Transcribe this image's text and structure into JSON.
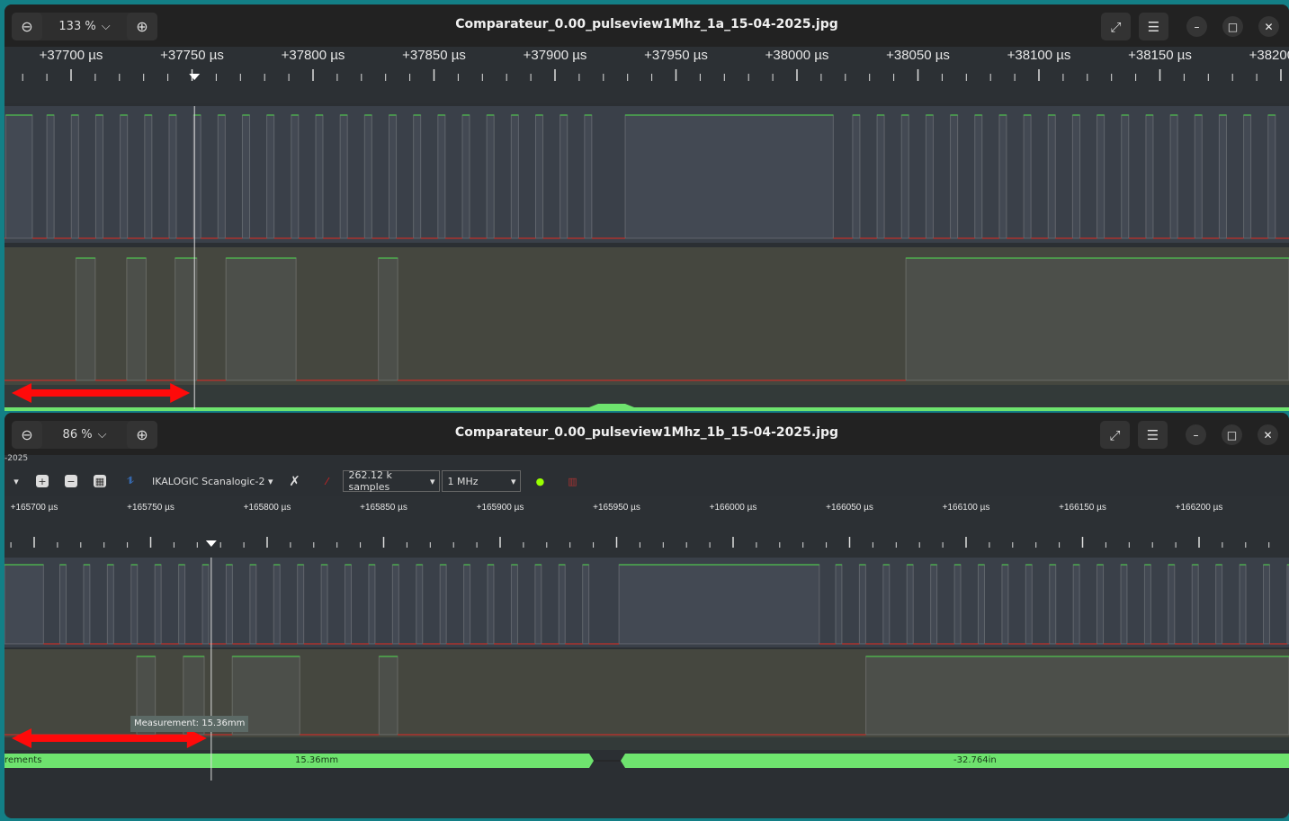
{
  "windows": [
    {
      "title": "Comparateur_0.00_pulseview1Mhz_1a_15-04-2025.jpg",
      "zoom": "133 %",
      "ruler": {
        "start": 37700,
        "end": 38200,
        "major_step": 50,
        "minor_step": 10,
        "unit": "µs",
        "labels": [
          "+37700 µs",
          "+37750 µs",
          "+37800 µs",
          "+37850 µs",
          "+37900 µs",
          "+37950 µs",
          "+38000 µs",
          "+38050 µs",
          "+38100 µs",
          "+38150 µs",
          "+38200 µs"
        ]
      },
      "cursor_us": 37751,
      "channels": [
        {
          "highs": [
            [
              37673,
              37684
            ],
            [
              37929,
              38015
            ]
          ],
          "trains": [
            {
              "start": 37690,
              "period": 10.1,
              "width": 3,
              "count": 23
            },
            {
              "start": 38023,
              "period": 10.1,
              "width": 3,
              "count": 19
            }
          ]
        },
        {
          "highs": [
            [
              37702,
              37710
            ],
            [
              37723,
              37731
            ],
            [
              37743,
              37752
            ],
            [
              37764,
              37793
            ],
            [
              37827,
              37835
            ],
            [
              38045,
              38220
            ]
          ],
          "trains": []
        }
      ]
    },
    {
      "title": "Comparateur_0.00_pulseview1Mhz_1b_15-04-2025.jpg",
      "zoom": "86 %",
      "subtitle": "-2025",
      "toolbar": {
        "device": "IKALOGIC Scanalogic-2",
        "samples": "262.12 k samples",
        "rate": "1 MHz"
      },
      "ruler": {
        "start": 165700,
        "end": 166210,
        "major_step": 50,
        "minor_step": 10,
        "unit": "µs",
        "labels": [
          "+165700 µs",
          "+165750 µs",
          "+165800 µs",
          "+165850 µs",
          "+165900 µs",
          "+165950 µs",
          "+166000 µs",
          "+166050 µs",
          "+166100 µs",
          "+166150 µs",
          "+166200 µs"
        ]
      },
      "cursor_us": 165776,
      "channels": [
        {
          "highs": [
            [
              165685,
              165704
            ],
            [
              165951,
              166037
            ]
          ],
          "trains": [
            {
              "start": 165711,
              "period": 10.2,
              "width": 2.7,
              "count": 23
            },
            {
              "start": 166044,
              "period": 10.2,
              "width": 2.7,
              "count": 20
            }
          ]
        },
        {
          "highs": [
            [
              165744,
              165752
            ],
            [
              165764,
              165773
            ],
            [
              165785,
              165814
            ],
            [
              165848,
              165856
            ],
            [
              166057,
              166250
            ]
          ],
          "trains": []
        }
      ],
      "tooltip": "Measurement: 15.36mm",
      "measurements": {
        "row_label": "rements",
        "value1": "15.36mm",
        "value2": "-32.764in"
      }
    }
  ],
  "colors": {
    "signal_high": "#4fc24f",
    "signal_low": "#c0302a",
    "arrow": "#ff0a0a",
    "measure_bar": "#6ee36e"
  }
}
